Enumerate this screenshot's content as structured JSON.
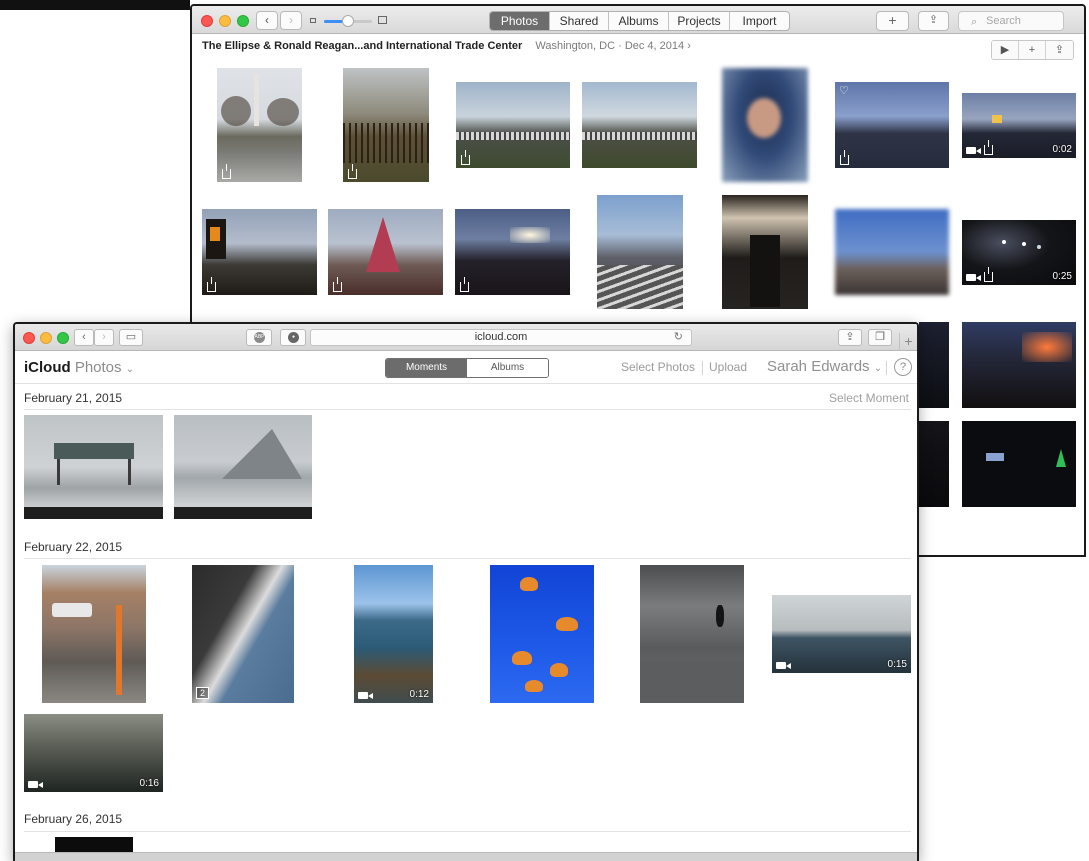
{
  "photos_app": {
    "tabs": [
      {
        "label": "Photos",
        "active": true
      },
      {
        "label": "Shared",
        "active": false
      },
      {
        "label": "Albums",
        "active": false
      },
      {
        "label": "Projects",
        "active": false
      },
      {
        "label": "Import",
        "active": false
      }
    ],
    "search_placeholder": "Search",
    "moment_title": "The Ellipse & Ronald Reagan...and International Trade Center",
    "moment_subtitle": "Washington, DC  ·  Dec 4, 2014 ›",
    "video_durations": [
      "0:02",
      "0:25"
    ]
  },
  "safari": {
    "url": "icloud.com"
  },
  "icloud": {
    "brand_bold": "iCloud",
    "brand_light": "Photos",
    "tabs": [
      {
        "label": "Moments",
        "active": true
      },
      {
        "label": "Albums",
        "active": false
      }
    ],
    "select_photos": "Select Photos",
    "upload": "Upload",
    "user": "Sarah Edwards",
    "select_moment": "Select Moment",
    "moments": [
      {
        "date": "February 21, 2015"
      },
      {
        "date": "February 22, 2015"
      },
      {
        "date": "February 26, 2015"
      }
    ],
    "feb22_durations": [
      "0:12",
      "0:15",
      "0:16"
    ],
    "stack_count": "2"
  },
  "icons": [
    "back-icon",
    "forward-icon",
    "add-icon",
    "share-icon",
    "search-icon",
    "play-icon",
    "heart-icon",
    "video-icon",
    "reload-icon",
    "sidebar-icon",
    "help-icon"
  ]
}
